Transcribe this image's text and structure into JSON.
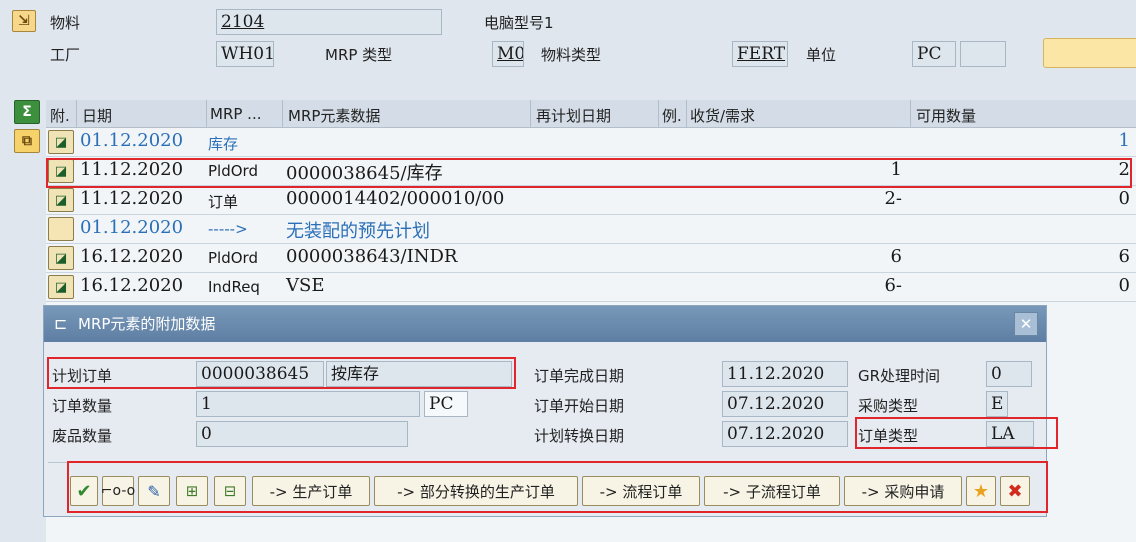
{
  "header": {
    "material_label": "物料",
    "material_value": "2104",
    "computer_model_label": "电脑型号1",
    "plant_label": "工厂",
    "plant_value": "WH01",
    "mrp_type_label": "MRP 类型",
    "mrp_type_value": "M0",
    "material_type_label": "物料类型",
    "material_type_value": "FERT",
    "unit_label": "单位",
    "unit_value": "PC"
  },
  "grid": {
    "columns": [
      "附.",
      "日期",
      "MRP ...",
      "MRP元素数据",
      "再计划日期",
      "例.",
      "收货/需求",
      "可用数量"
    ],
    "rows": [
      {
        "date": "01.12.2020",
        "mrp": "库存",
        "data": "",
        "qty": "",
        "avail": "1",
        "blue": true,
        "icon": "detail-icon"
      },
      {
        "date": "11.12.2020",
        "mrp": "PldOrd",
        "data": "0000038645/库存",
        "qty": "1",
        "avail": "2",
        "blue": false,
        "icon": "detail-icon"
      },
      {
        "date": "11.12.2020",
        "mrp": "订单",
        "data": "0000014402/000010/00",
        "qty": "2-",
        "avail": "0",
        "blue": false,
        "icon": "detail-icon"
      },
      {
        "date": "01.12.2020",
        "mrp": "----->",
        "data": "无装配的预先计划",
        "qty": "",
        "avail": "",
        "blue": true,
        "icon": "blank-icon"
      },
      {
        "date": "16.12.2020",
        "mrp": "PldOrd",
        "data": "0000038643/INDR",
        "qty": "6",
        "avail": "6",
        "blue": false,
        "icon": "detail-icon"
      },
      {
        "date": "16.12.2020",
        "mrp": "IndReq",
        "data": "VSE",
        "qty": "6-",
        "avail": "0",
        "blue": false,
        "icon": "detail-icon"
      }
    ]
  },
  "dialog": {
    "title": "MRP元素的附加数据",
    "planned_order_label": "计划订单",
    "planned_order_value": "0000038645",
    "planned_order_text": "按库存",
    "order_qty_label": "订单数量",
    "order_qty_value": "1",
    "order_qty_unit": "PC",
    "scrap_qty_label": "废品数量",
    "scrap_qty_value": "0",
    "finish_date_label": "订单完成日期",
    "finish_date_value": "11.12.2020",
    "start_date_label": "订单开始日期",
    "start_date_value": "07.12.2020",
    "conversion_date_label": "计划转换日期",
    "conversion_date_value": "07.12.2020",
    "gr_time_label": "GR处理时间",
    "gr_time_value": "0",
    "procurement_type_label": "采购类型",
    "procurement_type_value": "E",
    "order_type_label": "订单类型",
    "order_type_value": "LA",
    "buttons": {
      "production_order": "-> 生产订单",
      "partial_conversion": "-> 部分转换的生产订单",
      "process_order": "-> 流程订单",
      "sub_process_order": "-> 子流程订单",
      "purchase_requisition": "-> 采购申请"
    }
  },
  "colors": {
    "red_highlight": "#e0262b",
    "blue_text": "#2a6fb7",
    "title_bar": "#6d8db0"
  }
}
